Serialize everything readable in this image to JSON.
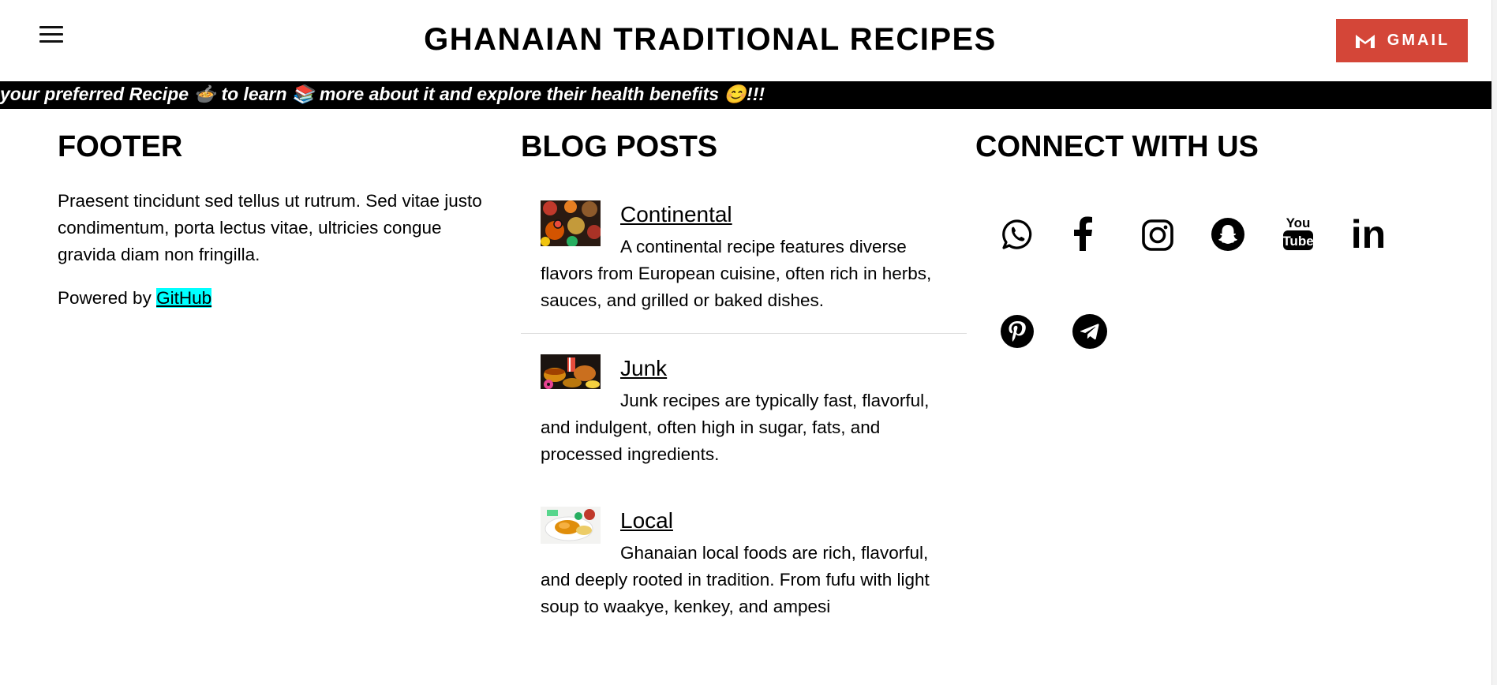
{
  "header": {
    "title": "GHANAIAN TRADITIONAL RECIPES",
    "gmail_label": "GMAIL"
  },
  "marquee": {
    "text": "your preferred Recipe 🍲 to learn 📚 more about it and explore their health benefits 😊!!!"
  },
  "footer": {
    "heading": "FOOTER",
    "text": "Praesent tincidunt sed tellus ut rutrum. Sed vitae justo condimentum, porta lectus vitae, ultricies congue gravida diam non fringilla.",
    "powered_prefix": "Powered by",
    "powered_link": "GitHub"
  },
  "blog": {
    "heading": "BLOG POSTS",
    "posts": [
      {
        "title": "Continental",
        "desc": "A continental recipe features diverse flavors from European cuisine, often rich in herbs, sauces, and grilled or baked dishes."
      },
      {
        "title": "Junk",
        "desc": "Junk recipes are typically fast, flavorful, and indulgent, often high in sugar, fats, and processed ingredients."
      },
      {
        "title": "Local",
        "desc": "Ghanaian local foods are rich, flavorful, and deeply rooted in tradition. From fufu with light soup to waakye, kenkey, and ampesi"
      }
    ]
  },
  "connect": {
    "heading": "CONNECT WITH US",
    "icons": [
      "whatsapp-icon",
      "facebook-icon",
      "instagram-icon",
      "snapchat-icon",
      "youtube-icon",
      "linkedin-icon",
      "pinterest-icon",
      "telegram-icon"
    ],
    "youtube_top": "You",
    "youtube_bottom": "Tube",
    "linkedin_text": "in"
  },
  "colors": {
    "gmail": "#d44638",
    "marquee_bg": "#000000",
    "link_highlight": "#00ffff"
  }
}
